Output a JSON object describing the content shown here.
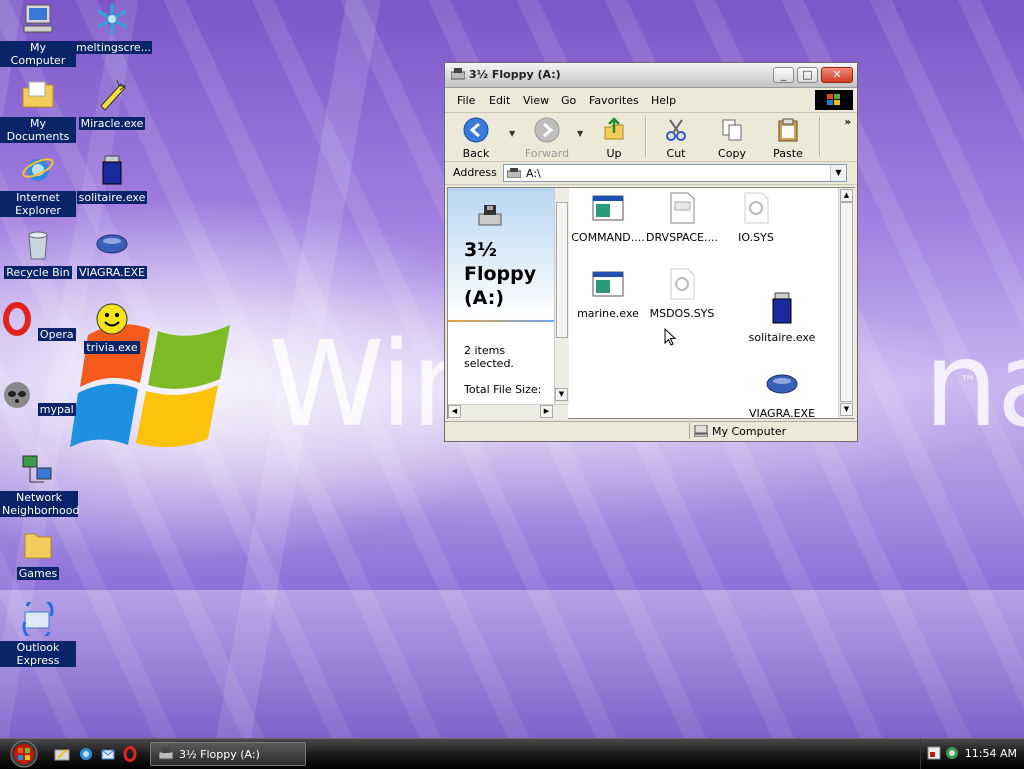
{
  "desktop": {
    "brand_text": "Win",
    "brand_text_end": "na",
    "brand_tm": "™",
    "icons": [
      {
        "label": "My Computer"
      },
      {
        "label": "meltingscre..."
      },
      {
        "label": "My Documents"
      },
      {
        "label": "Miracle.exe"
      },
      {
        "label": "Internet Explorer"
      },
      {
        "label": "solitaire.exe"
      },
      {
        "label": "Recycle Bin"
      },
      {
        "label": "VIAGRA.EXE"
      },
      {
        "label": "Opera"
      },
      {
        "label": "trivia.exe"
      },
      {
        "label": "mypal"
      },
      {
        "label": "Network Neighborhood"
      },
      {
        "label": "Games"
      },
      {
        "label": "Outlook Express"
      }
    ]
  },
  "window": {
    "title": "3½ Floppy (A:)",
    "menu": [
      "File",
      "Edit",
      "View",
      "Go",
      "Favorites",
      "Help"
    ],
    "toolbar": {
      "back": "Back",
      "forward": "Forward",
      "up": "Up",
      "cut": "Cut",
      "copy": "Copy",
      "paste": "Paste"
    },
    "address": {
      "label": "Address",
      "value": "A:\\"
    },
    "left_pane": {
      "title": "3½ Floppy (A:)",
      "selection": "2 items selected.",
      "total": "Total File Size:"
    },
    "files": [
      {
        "name": "COMMAND...."
      },
      {
        "name": "DRVSPACE...."
      },
      {
        "name": "IO.SYS"
      },
      {
        "name": "marine.exe"
      },
      {
        "name": "MSDOS.SYS"
      },
      {
        "name": "solitaire.exe"
      },
      {
        "name": "VIAGRA.EXE"
      }
    ],
    "status": "My Computer"
  },
  "taskbar": {
    "task_label": "3½ Floppy (A:)",
    "clock": "11:54 AM"
  },
  "colors": {
    "selection": "#0a246a",
    "wallpaper": "#a17fe0",
    "taskbar": "#1a1a1a"
  }
}
